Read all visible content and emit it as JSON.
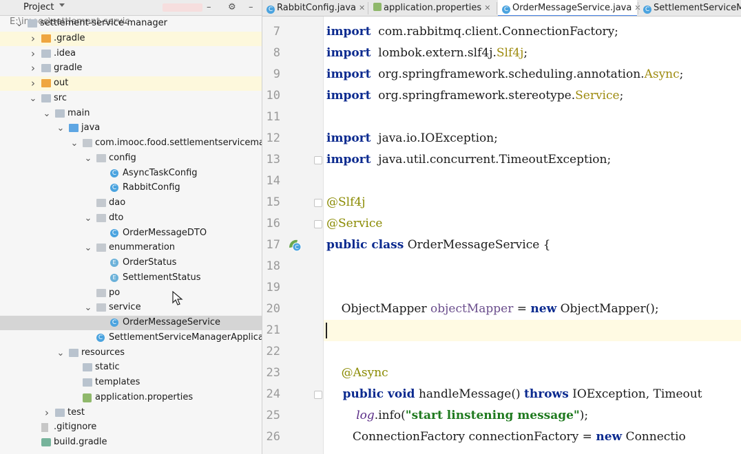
{
  "project_panel": {
    "title": "Project",
    "tree": [
      {
        "label": "settlement-service-manager",
        "path": "E:\\imooc\\settlement-servic",
        "depth": 0,
        "caret": "down",
        "icon": "module-folder-icon"
      },
      {
        "label": ".gradle",
        "depth": 1,
        "caret": "right",
        "icon": "folder-orange-icon",
        "highlight": true
      },
      {
        "label": ".idea",
        "depth": 1,
        "caret": "right",
        "icon": "folder-icon"
      },
      {
        "label": "gradle",
        "depth": 1,
        "caret": "right",
        "icon": "folder-icon"
      },
      {
        "label": "out",
        "depth": 1,
        "caret": "right",
        "icon": "folder-orange-icon",
        "highlight": true
      },
      {
        "label": "src",
        "depth": 1,
        "caret": "down",
        "icon": "folder-icon"
      },
      {
        "label": "main",
        "depth": 2,
        "caret": "down",
        "icon": "folder-icon"
      },
      {
        "label": "java",
        "depth": 3,
        "caret": "down",
        "icon": "folder-blue-icon"
      },
      {
        "label": "com.imooc.food.settlementservicemanage",
        "depth": 4,
        "caret": "down",
        "icon": "package-icon"
      },
      {
        "label": "config",
        "depth": 5,
        "caret": "down",
        "icon": "package-icon"
      },
      {
        "label": "AsyncTaskConfig",
        "depth": 6,
        "caret": "",
        "icon": "class-icon"
      },
      {
        "label": "RabbitConfig",
        "depth": 6,
        "caret": "",
        "icon": "class-icon"
      },
      {
        "label": "dao",
        "depth": 5,
        "caret": "",
        "icon": "package-icon"
      },
      {
        "label": "dto",
        "depth": 5,
        "caret": "down",
        "icon": "package-icon"
      },
      {
        "label": "OrderMessageDTO",
        "depth": 6,
        "caret": "",
        "icon": "class-icon"
      },
      {
        "label": "enummeration",
        "depth": 5,
        "caret": "down",
        "icon": "package-icon"
      },
      {
        "label": "OrderStatus",
        "depth": 6,
        "caret": "",
        "icon": "enum-icon"
      },
      {
        "label": "SettlementStatus",
        "depth": 6,
        "caret": "",
        "icon": "enum-icon"
      },
      {
        "label": "po",
        "depth": 5,
        "caret": "",
        "icon": "package-icon"
      },
      {
        "label": "service",
        "depth": 5,
        "caret": "down",
        "icon": "package-icon"
      },
      {
        "label": "OrderMessageService",
        "depth": 6,
        "caret": "",
        "icon": "class-icon",
        "selected": true
      },
      {
        "label": "SettlementServiceManagerApplication",
        "depth": 5,
        "caret": "",
        "icon": "spring-class-icon"
      },
      {
        "label": "resources",
        "depth": 3,
        "caret": "down",
        "icon": "resources-folder-icon"
      },
      {
        "label": "static",
        "depth": 4,
        "caret": "",
        "icon": "folder-icon"
      },
      {
        "label": "templates",
        "depth": 4,
        "caret": "",
        "icon": "folder-icon"
      },
      {
        "label": "application.properties",
        "depth": 4,
        "caret": "",
        "icon": "properties-file-icon"
      },
      {
        "label": "test",
        "depth": 2,
        "caret": "right",
        "icon": "folder-icon"
      },
      {
        "label": ".gitignore",
        "depth": 1,
        "caret": "",
        "icon": "file-icon"
      },
      {
        "label": "build.gradle",
        "depth": 1,
        "caret": "",
        "icon": "gradle-file-icon"
      }
    ]
  },
  "tabs": [
    {
      "label": "RabbitConfig.java",
      "icon": "class-icon",
      "active": false
    },
    {
      "label": "application.properties",
      "icon": "properties-file-icon",
      "active": false
    },
    {
      "label": "OrderMessageService.java",
      "icon": "class-icon",
      "active": true
    },
    {
      "label": "SettlementServiceMa",
      "icon": "spring-class-icon",
      "active": false
    }
  ],
  "editor": {
    "current_line": 21,
    "lines": [
      {
        "n": "7",
        "segs": [
          [
            "kw",
            "import"
          ],
          [
            "",
            "  com.rabbitmq.client.ConnectionFactory;"
          ]
        ]
      },
      {
        "n": "8",
        "segs": [
          [
            "kw",
            "import"
          ],
          [
            "",
            "  lombok.extern.slf4j."
          ],
          [
            "yel",
            "Slf4j"
          ],
          [
            "",
            ";"
          ]
        ]
      },
      {
        "n": "9",
        "segs": [
          [
            "kw",
            "import"
          ],
          [
            "",
            "  org.springframework.scheduling.annotation."
          ],
          [
            "yel",
            "Async"
          ],
          [
            "",
            ";"
          ]
        ]
      },
      {
        "n": "10",
        "segs": [
          [
            "kw",
            "import"
          ],
          [
            "",
            "  org.springframework.stereotype."
          ],
          [
            "yel",
            "Service"
          ],
          [
            "",
            ";"
          ]
        ]
      },
      {
        "n": "11",
        "segs": []
      },
      {
        "n": "12",
        "segs": [
          [
            "kw",
            "import"
          ],
          [
            "",
            "  java.io.IOException;"
          ]
        ]
      },
      {
        "n": "13",
        "segs": [
          [
            "kw",
            "import"
          ],
          [
            "",
            "  java.util.concurrent.TimeoutException;"
          ]
        ]
      },
      {
        "n": "14",
        "segs": []
      },
      {
        "n": "15",
        "segs": [
          [
            "ann",
            "@Slf4j"
          ]
        ]
      },
      {
        "n": "16",
        "segs": [
          [
            "ann",
            "@Service"
          ]
        ]
      },
      {
        "n": "17",
        "segs": [
          [
            "kw",
            "public class"
          ],
          [
            "",
            " OrderMessageService {"
          ]
        ]
      },
      {
        "n": "18",
        "segs": []
      },
      {
        "n": "19",
        "segs": []
      },
      {
        "n": "20",
        "segs": [
          [
            "",
            "    ObjectMapper "
          ],
          [
            "fld",
            "objectMapper"
          ],
          [
            "",
            " = "
          ],
          [
            "kw",
            "new"
          ],
          [
            "",
            " ObjectMapper();"
          ]
        ]
      },
      {
        "n": "21",
        "segs": []
      },
      {
        "n": "22",
        "segs": []
      },
      {
        "n": "23",
        "segs": [
          [
            "ann",
            "    @Async"
          ]
        ]
      },
      {
        "n": "24",
        "segs": [
          [
            "kw",
            "    public void"
          ],
          [
            "",
            " handleMessage() "
          ],
          [
            "kw",
            "throws"
          ],
          [
            "",
            " IOException, Timeout"
          ]
        ]
      },
      {
        "n": "25",
        "segs": [
          [
            "ital",
            "        log"
          ],
          [
            "",
            ".info("
          ],
          [
            "str",
            "\"start linstening message\""
          ],
          [
            "",
            ");"
          ]
        ]
      },
      {
        "n": "26",
        "segs": [
          [
            "",
            "       ConnectionFactory connectionFactory = "
          ],
          [
            "kw",
            "new"
          ],
          [
            "",
            " Connectio"
          ]
        ]
      }
    ]
  }
}
